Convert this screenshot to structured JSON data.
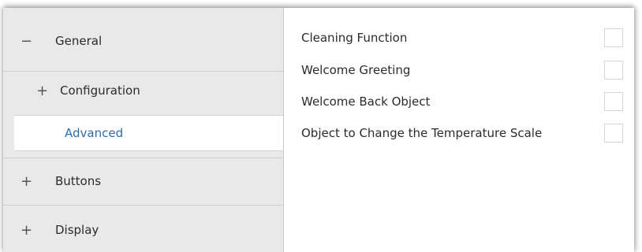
{
  "sidebar": {
    "items": [
      {
        "sign": "−",
        "label": "General"
      },
      {
        "sign": "+",
        "label": "Configuration"
      },
      {
        "sign": "",
        "label": "Advanced"
      },
      {
        "sign": "+",
        "label": "Buttons"
      },
      {
        "sign": "+",
        "label": "Display"
      }
    ]
  },
  "main": {
    "options": [
      {
        "label": "Cleaning Function",
        "checked": false
      },
      {
        "label": "Welcome Greeting",
        "checked": false
      },
      {
        "label": "Welcome Back Object",
        "checked": false
      },
      {
        "label": "Object to Change the Temperature Scale",
        "checked": false
      }
    ]
  },
  "colors": {
    "accent": "#2e6da8",
    "sidebar_bg": "#e9e9e9"
  }
}
